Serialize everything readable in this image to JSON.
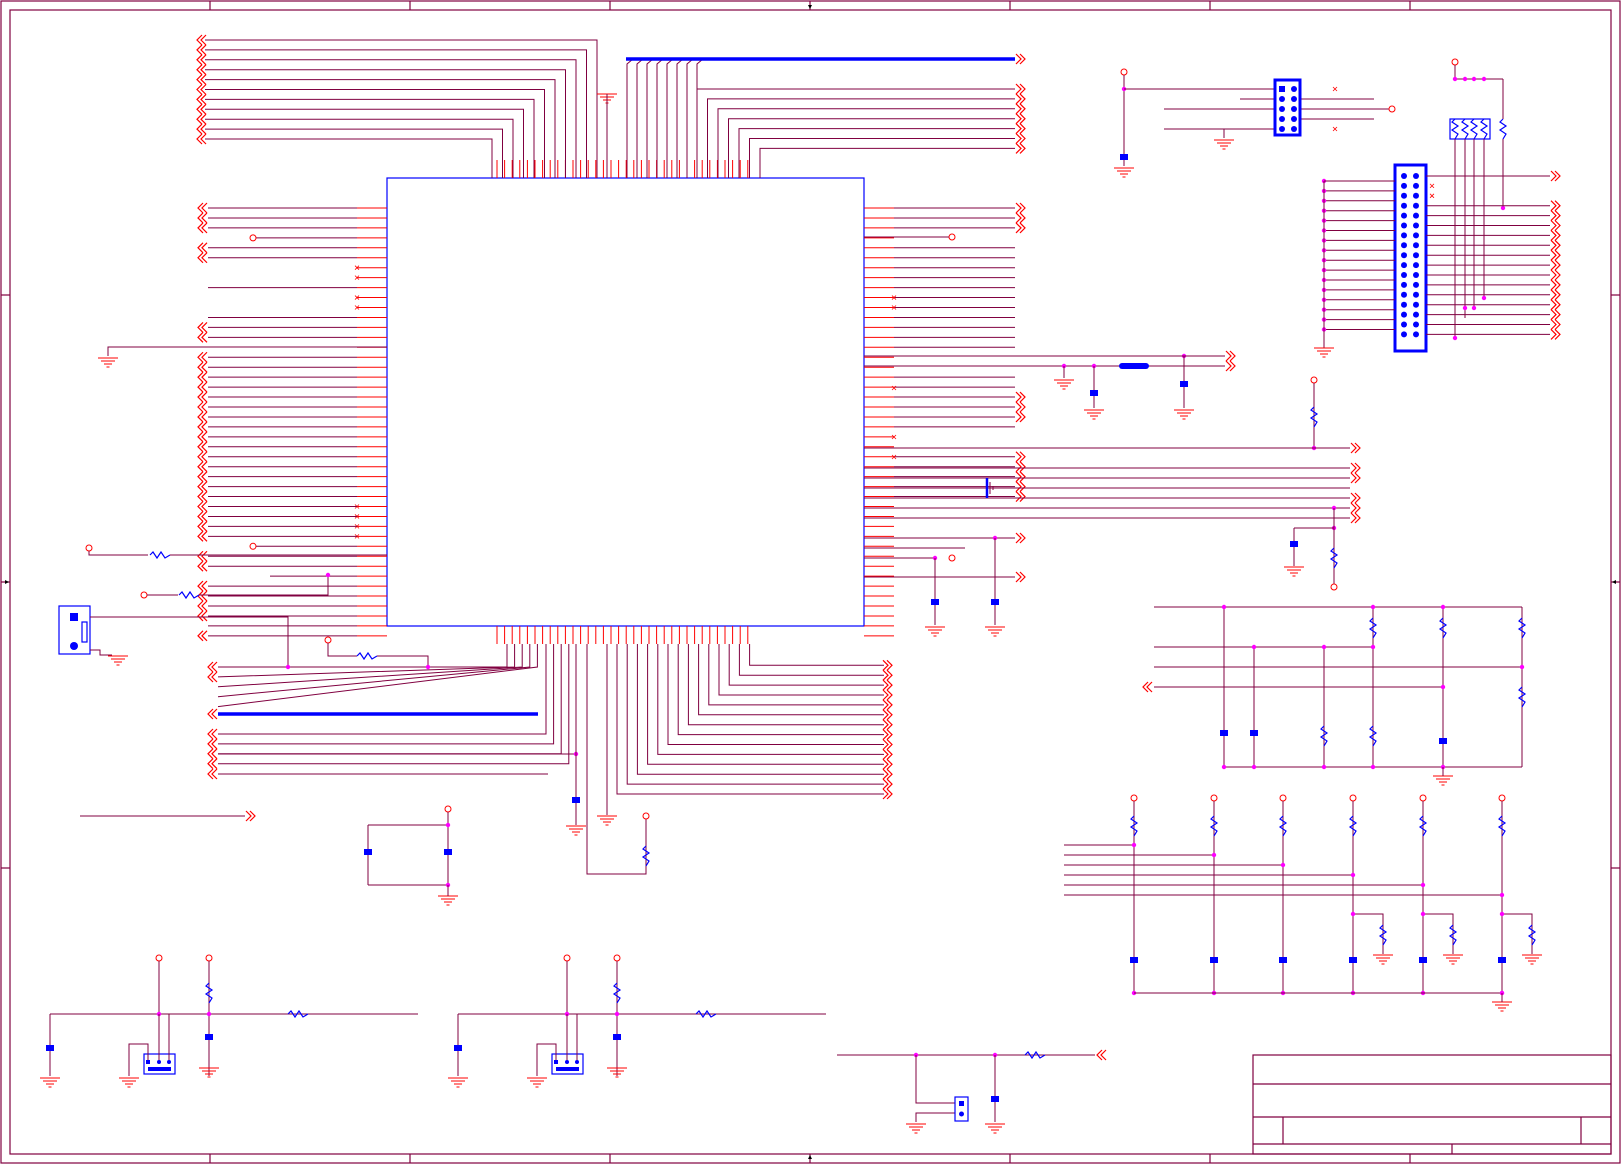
{
  "sheet": {
    "title_block": {
      "rows": [
        "",
        "",
        ""
      ]
    }
  },
  "colors": {
    "wire": "#800040",
    "pin": "#ff0000",
    "component": "#0000ff",
    "junction": "#ff00ff"
  },
  "icon_names": [
    "ground-icon",
    "power-port-icon",
    "resistor-icon",
    "capacitor-icon",
    "connector-icon",
    "offsheet-port-icon"
  ]
}
